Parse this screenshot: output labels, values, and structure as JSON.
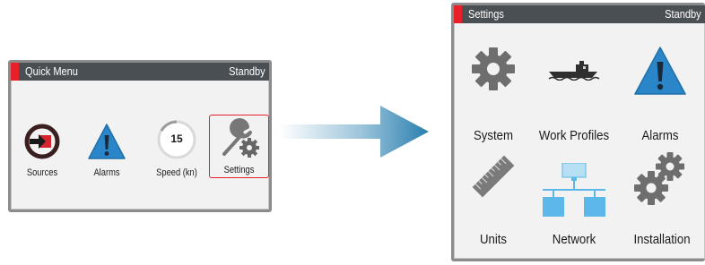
{
  "quick_menu": {
    "title": "Quick Menu",
    "status": "Standby",
    "items": [
      {
        "label": "Sources",
        "icon": "sources-icon"
      },
      {
        "label": "Alarms",
        "icon": "alarm-icon"
      },
      {
        "label": "Speed (kn)",
        "icon": "speed-gauge-icon",
        "value": "15"
      },
      {
        "label": "Settings",
        "icon": "settings-icon",
        "selected": true
      }
    ]
  },
  "settings_menu": {
    "title": "Settings",
    "status": "Standby",
    "items": [
      {
        "label": "System",
        "icon": "gear-icon"
      },
      {
        "label": "Work Profiles",
        "icon": "boat-icon"
      },
      {
        "label": "Alarms",
        "icon": "alarm-icon"
      },
      {
        "label": "Units",
        "icon": "ruler-icon"
      },
      {
        "label": "Network",
        "icon": "network-icon"
      },
      {
        "label": "Installation",
        "icon": "installation-gears-icon"
      }
    ]
  },
  "colors": {
    "title_bar": "#4a4f54",
    "accent_red": "#e8202a",
    "alarm_blue": "#2a86c8",
    "network_blue": "#5cb8e8",
    "gear_gray": "#6e6e6e"
  }
}
